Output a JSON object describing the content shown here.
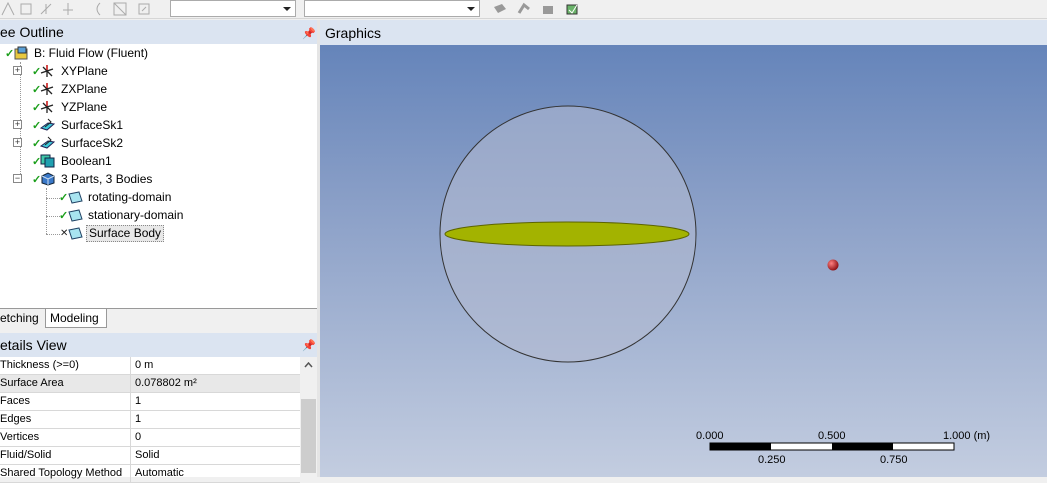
{
  "toolbar": {
    "combo1_value": "",
    "combo2_value": ""
  },
  "tree_outline": {
    "title": "ee Outline",
    "root": "B: Fluid Flow (Fluent)",
    "items": [
      {
        "label": "XYPlane",
        "icon": "plane-axes-icon",
        "status": "check",
        "expander": "+"
      },
      {
        "label": "ZXPlane",
        "icon": "plane-axes-icon",
        "status": "check",
        "expander": ""
      },
      {
        "label": "YZPlane",
        "icon": "plane-axes-icon",
        "status": "check",
        "expander": ""
      },
      {
        "label": "SurfaceSk1",
        "icon": "surface-sketch-icon",
        "status": "check",
        "expander": "+"
      },
      {
        "label": "SurfaceSk2",
        "icon": "surface-sketch-icon",
        "status": "check",
        "expander": "+"
      },
      {
        "label": "Boolean1",
        "icon": "boolean-icon",
        "status": "check",
        "expander": ""
      },
      {
        "label": "3 Parts, 3 Bodies",
        "icon": "parts-bodies-icon",
        "status": "check",
        "expander": "-"
      }
    ],
    "bodies": [
      {
        "label": "rotating-domain",
        "status": "check"
      },
      {
        "label": "stationary-domain",
        "status": "check"
      },
      {
        "label": "Surface Body",
        "status": "x"
      }
    ]
  },
  "tabs": {
    "sketching": "etching",
    "modeling": "Modeling"
  },
  "details_view": {
    "title": "etails View",
    "rows": [
      {
        "label": "Thickness (>=0)",
        "value": "0 m"
      },
      {
        "label": "Surface Area",
        "value": "0.078802 m²"
      },
      {
        "label": "Faces",
        "value": "1"
      },
      {
        "label": "Edges",
        "value": "1"
      },
      {
        "label": "Vertices",
        "value": "0"
      },
      {
        "label": "Fluid/Solid",
        "value": "Solid"
      },
      {
        "label": "Shared Topology Method",
        "value": "Automatic"
      }
    ]
  },
  "graphics": {
    "title": "Graphics",
    "scale_labels_top": [
      "0.000",
      "0.500",
      "1.000 (m)"
    ],
    "scale_labels_bottom": [
      "0.250",
      "0.750"
    ]
  },
  "colors": {
    "disc": "#a3b300",
    "sphere_fill": "#b4bcd1",
    "point": "#c0141a",
    "header_bg": "#dbe4f1"
  }
}
